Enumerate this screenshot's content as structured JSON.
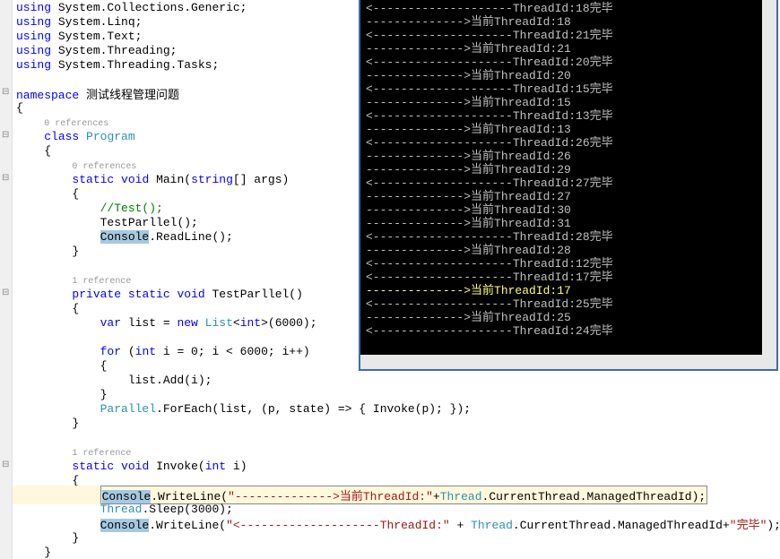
{
  "editor": {
    "lines": [
      {
        "indent": 0,
        "tokens": [
          {
            "t": "kw",
            "v": "using"
          },
          {
            "t": "pln",
            "v": " System.Collections.Generic;"
          }
        ]
      },
      {
        "indent": 0,
        "tokens": [
          {
            "t": "kw",
            "v": "using"
          },
          {
            "t": "pln",
            "v": " System.Linq;"
          }
        ]
      },
      {
        "indent": 0,
        "tokens": [
          {
            "t": "kw",
            "v": "using"
          },
          {
            "t": "pln",
            "v": " System.Text;"
          }
        ]
      },
      {
        "indent": 0,
        "tokens": [
          {
            "t": "kw",
            "v": "using"
          },
          {
            "t": "pln",
            "v": " System.Threading;"
          }
        ]
      },
      {
        "indent": 0,
        "tokens": [
          {
            "t": "kw",
            "v": "using"
          },
          {
            "t": "pln",
            "v": " System.Threading.Tasks;"
          }
        ]
      },
      {
        "indent": 0,
        "tokens": []
      },
      {
        "indent": 0,
        "marker": true,
        "tokens": [
          {
            "t": "kw",
            "v": "namespace"
          },
          {
            "t": "pln",
            "v": " 测试线程管理问题"
          }
        ]
      },
      {
        "indent": 0,
        "tokens": [
          {
            "t": "pln",
            "v": "{"
          }
        ]
      },
      {
        "indent": 1,
        "tokens": [
          {
            "t": "ref",
            "v": "0 references"
          }
        ]
      },
      {
        "indent": 1,
        "marker": true,
        "tokens": [
          {
            "t": "kw",
            "v": "class"
          },
          {
            "t": "pln",
            "v": " "
          },
          {
            "t": "cls",
            "v": "Program"
          }
        ]
      },
      {
        "indent": 1,
        "tokens": [
          {
            "t": "pln",
            "v": "{"
          }
        ]
      },
      {
        "indent": 2,
        "tokens": [
          {
            "t": "ref",
            "v": "0 references"
          }
        ]
      },
      {
        "indent": 2,
        "marker": true,
        "tokens": [
          {
            "t": "kw",
            "v": "static"
          },
          {
            "t": "pln",
            "v": " "
          },
          {
            "t": "kw",
            "v": "void"
          },
          {
            "t": "pln",
            "v": " Main("
          },
          {
            "t": "kw",
            "v": "string"
          },
          {
            "t": "pln",
            "v": "[] args)"
          }
        ]
      },
      {
        "indent": 2,
        "tokens": [
          {
            "t": "pln",
            "v": "{"
          }
        ]
      },
      {
        "indent": 3,
        "tokens": [
          {
            "t": "cmt",
            "v": "//Test();"
          }
        ]
      },
      {
        "indent": 3,
        "tokens": [
          {
            "t": "pln",
            "v": "TestParllel();"
          }
        ]
      },
      {
        "indent": 3,
        "tokens": [
          {
            "t": "sel",
            "v": "Console"
          },
          {
            "t": "pln",
            "v": ".ReadLine();"
          }
        ]
      },
      {
        "indent": 2,
        "tokens": [
          {
            "t": "pln",
            "v": "}"
          }
        ]
      },
      {
        "indent": 0,
        "tokens": []
      },
      {
        "indent": 2,
        "tokens": [
          {
            "t": "ref",
            "v": "1 reference"
          }
        ]
      },
      {
        "indent": 2,
        "marker": true,
        "tokens": [
          {
            "t": "kw",
            "v": "private"
          },
          {
            "t": "pln",
            "v": " "
          },
          {
            "t": "kw",
            "v": "static"
          },
          {
            "t": "pln",
            "v": " "
          },
          {
            "t": "kw",
            "v": "void"
          },
          {
            "t": "pln",
            "v": " TestParllel()"
          }
        ]
      },
      {
        "indent": 2,
        "tokens": [
          {
            "t": "pln",
            "v": "{"
          }
        ]
      },
      {
        "indent": 3,
        "tokens": [
          {
            "t": "kw",
            "v": "var"
          },
          {
            "t": "pln",
            "v": " list = "
          },
          {
            "t": "kw",
            "v": "new"
          },
          {
            "t": "pln",
            "v": " "
          },
          {
            "t": "cls",
            "v": "List"
          },
          {
            "t": "pln",
            "v": "<"
          },
          {
            "t": "kw",
            "v": "int"
          },
          {
            "t": "pln",
            "v": ">(6000);"
          }
        ]
      },
      {
        "indent": 0,
        "tokens": []
      },
      {
        "indent": 3,
        "tokens": [
          {
            "t": "kw",
            "v": "for"
          },
          {
            "t": "pln",
            "v": " ("
          },
          {
            "t": "kw",
            "v": "int"
          },
          {
            "t": "pln",
            "v": " i = 0; i < 6000; i++)"
          }
        ]
      },
      {
        "indent": 3,
        "tokens": [
          {
            "t": "pln",
            "v": "{"
          }
        ]
      },
      {
        "indent": 4,
        "tokens": [
          {
            "t": "pln",
            "v": "list.Add(i);"
          }
        ]
      },
      {
        "indent": 3,
        "tokens": [
          {
            "t": "pln",
            "v": "}"
          }
        ]
      },
      {
        "indent": 3,
        "tokens": [
          {
            "t": "cls",
            "v": "Parallel"
          },
          {
            "t": "pln",
            "v": ".ForEach(list, (p, state) => { Invoke(p); });"
          }
        ]
      },
      {
        "indent": 2,
        "tokens": [
          {
            "t": "pln",
            "v": "}"
          }
        ]
      },
      {
        "indent": 0,
        "tokens": []
      },
      {
        "indent": 2,
        "tokens": [
          {
            "t": "ref",
            "v": "1 reference"
          }
        ]
      },
      {
        "indent": 2,
        "marker": true,
        "tokens": [
          {
            "t": "kw",
            "v": "static"
          },
          {
            "t": "pln",
            "v": " "
          },
          {
            "t": "kw",
            "v": "void"
          },
          {
            "t": "pln",
            "v": " Invoke("
          },
          {
            "t": "kw",
            "v": "int"
          },
          {
            "t": "pln",
            "v": " i)"
          }
        ]
      },
      {
        "indent": 2,
        "tokens": [
          {
            "t": "pln",
            "v": "{"
          }
        ]
      },
      {
        "indent": 3,
        "highlight": true,
        "tokens": [
          {
            "t": "sel",
            "v": "Console"
          },
          {
            "t": "pln",
            "v": ".WriteLine("
          },
          {
            "t": "str",
            "v": "\"-------------->当前ThreadId:\""
          },
          {
            "t": "pln",
            "v": "+"
          },
          {
            "t": "cls",
            "v": "Thread"
          },
          {
            "t": "pln",
            "v": ".CurrentThread.ManagedThreadId);"
          }
        ]
      },
      {
        "indent": 3,
        "tokens": [
          {
            "t": "cls",
            "v": "Thread"
          },
          {
            "t": "pln",
            "v": ".Sleep(3000);"
          }
        ]
      },
      {
        "indent": 3,
        "tokens": [
          {
            "t": "sel",
            "v": "Console"
          },
          {
            "t": "pln",
            "v": ".WriteLine("
          },
          {
            "t": "str",
            "v": "\"<--------------------ThreadId:\""
          },
          {
            "t": "pln",
            "v": " + "
          },
          {
            "t": "cls",
            "v": "Thread"
          },
          {
            "t": "pln",
            "v": ".CurrentThread.ManagedThreadId+"
          },
          {
            "t": "str",
            "v": "\"完毕\""
          },
          {
            "t": "pln",
            "v": ");"
          }
        ]
      },
      {
        "indent": 2,
        "tokens": [
          {
            "t": "pln",
            "v": "}"
          }
        ]
      },
      {
        "indent": 1,
        "tokens": [
          {
            "t": "pln",
            "v": "}"
          }
        ]
      }
    ]
  },
  "console": {
    "lines": [
      {
        "type": "end",
        "id": 18
      },
      {
        "type": "cur",
        "id": 18
      },
      {
        "type": "end",
        "id": 21
      },
      {
        "type": "cur",
        "id": 21
      },
      {
        "type": "end",
        "id": 20
      },
      {
        "type": "cur",
        "id": 20
      },
      {
        "type": "end",
        "id": 15
      },
      {
        "type": "cur",
        "id": 15
      },
      {
        "type": "end",
        "id": 13
      },
      {
        "type": "cur",
        "id": 13
      },
      {
        "type": "end",
        "id": 26
      },
      {
        "type": "cur",
        "id": 26
      },
      {
        "type": "cur",
        "id": 29
      },
      {
        "type": "end",
        "id": 27
      },
      {
        "type": "cur",
        "id": 27
      },
      {
        "type": "cur",
        "id": 30
      },
      {
        "type": "cur",
        "id": 31
      },
      {
        "type": "end",
        "id": 28
      },
      {
        "type": "cur",
        "id": 28
      },
      {
        "type": "end",
        "id": 12
      },
      {
        "type": "end",
        "id": 17
      },
      {
        "type": "cur",
        "id": 17,
        "mark": true
      },
      {
        "type": "end",
        "id": 25
      },
      {
        "type": "cur",
        "id": 25
      },
      {
        "type": "end",
        "id": 24
      }
    ],
    "prefix_end": "<--------------------ThreadId:",
    "prefix_cur": "-------------->当前ThreadId:",
    "suffix_end": "完毕"
  }
}
